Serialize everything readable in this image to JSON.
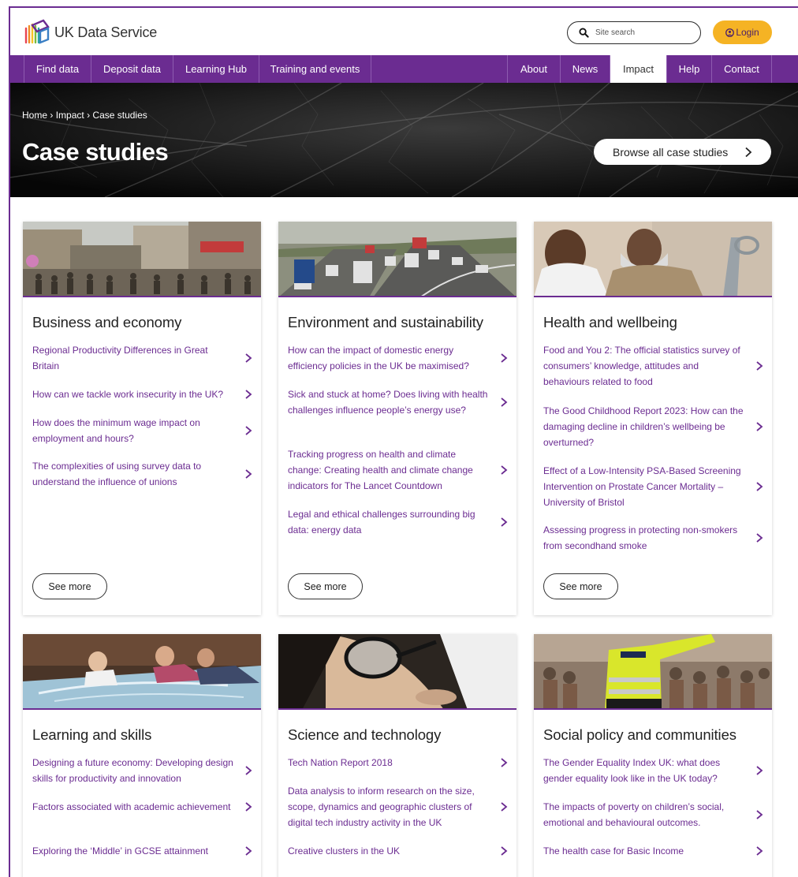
{
  "header": {
    "logo_text": "UK Data Service",
    "search_placeholder": "Site search",
    "login_label": "Login"
  },
  "nav": {
    "left": [
      "Find data",
      "Deposit data",
      "Learning Hub",
      "Training and events"
    ],
    "right": [
      "About",
      "News",
      "Impact",
      "Help",
      "Contact"
    ],
    "active": "Impact"
  },
  "hero": {
    "breadcrumb": [
      "Home",
      "Impact",
      "Case studies"
    ],
    "breadcrumb_sep": "›",
    "title": "Case studies",
    "browse_label": "Browse all case studies"
  },
  "cards": [
    {
      "title": "Business and economy",
      "links": [
        "Regional Productivity Differences in Great Britain",
        "How can we tackle work insecurity in the UK?",
        "How does the minimum wage impact on employment and hours?",
        "The complexities of using survey data to understand the influence of unions"
      ],
      "see_more": "See more"
    },
    {
      "title": "Environment and sustainability",
      "links": [
        "How can the impact of domestic energy efficiency policies in the UK be maximised?",
        "Sick and stuck at home? Does living with health challenges influence people’s energy use?",
        "Tracking progress on health and climate change: Creating health and climate change indicators for The Lancet Countdown",
        "Legal and ethical challenges surrounding big data: energy data"
      ],
      "see_more": "See more"
    },
    {
      "title": "Health and wellbeing",
      "links": [
        "Food and You 2: The official statistics survey of consumers’ knowledge, attitudes and behaviours related to food",
        "The Good Childhood Report 2023: How can the damaging decline in children’s wellbeing be overturned?",
        "Effect of a Low-Intensity PSA-Based Screening Intervention on Prostate Cancer Mortality – University of Bristol",
        "Assessing progress in protecting non-smokers from secondhand smoke"
      ],
      "see_more": "See more"
    },
    {
      "title": "Learning and skills",
      "links": [
        "Designing a future economy: Developing design skills for productivity and innovation",
        "Factors associated with academic achievement",
        "Exploring the ‘Middle’ in GCSE attainment"
      ]
    },
    {
      "title": "Science and technology",
      "links": [
        "Tech Nation Report 2018",
        "Data analysis to inform research on the size, scope, dynamics and geographic clusters of digital tech industry activity in the UK",
        "Creative clusters in the UK"
      ]
    },
    {
      "title": "Social policy and communities",
      "links": [
        "The Gender Equality Index UK: what does gender equality look like in the UK today?",
        "The impacts of poverty on children’s social, emotional and behavioural outcomes.",
        "The health case for Basic Income"
      ]
    }
  ],
  "colors": {
    "brand_purple": "#6b2c91",
    "login_yellow": "#f5b324"
  }
}
